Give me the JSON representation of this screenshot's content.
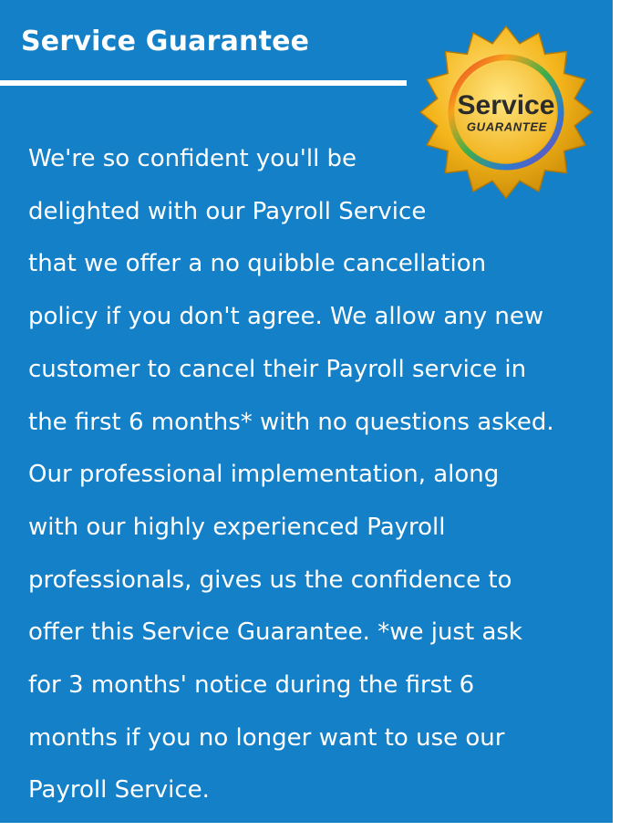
{
  "title": "Service Guarantee",
  "badge": {
    "line1": "Service",
    "line2": "GUARANTEE"
  },
  "body_lines": [
    "We're so confident you'll be",
    "delighted with our Payroll Service",
    "that we offer a no quibble cancellation",
    "policy if you don't agree. We allow any new",
    "customer to cancel their Payroll service in",
    "the first 6 months* with no questions asked.",
    "Our professional implementation, along",
    "with our highly experienced Payroll",
    "professionals, gives us the confidence to",
    "offer this Service Guarantee. *we just ask",
    "for 3 months' notice during the first 6",
    "months if you no longer want to use our",
    "Payroll Service."
  ],
  "colors": {
    "background": "#1480c8",
    "text": "#ffffff",
    "badge_gold": "#f2b419"
  }
}
